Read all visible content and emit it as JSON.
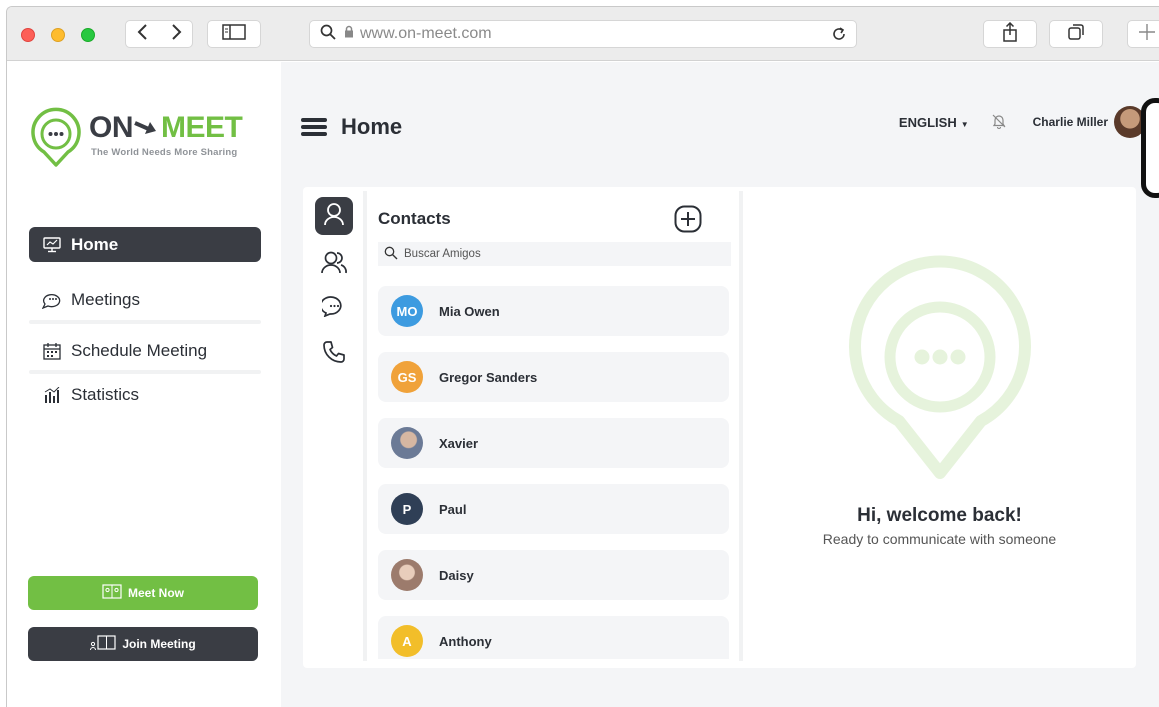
{
  "browser": {
    "url": "www.on-meet.com",
    "colors": {
      "close": "#fd5f57",
      "minimize": "#febc2e",
      "zoom": "#28c840"
    }
  },
  "brand": {
    "name_on": "ON",
    "name_meet": "MEET",
    "tagline": "The World Needs More Sharing",
    "accent": "#72bf44",
    "dark": "#3a3d44"
  },
  "sidebar": {
    "items": [
      {
        "label": "Home",
        "icon": "home-monitor-icon",
        "active": true
      },
      {
        "label": "Meetings",
        "icon": "chat-bubbles-icon",
        "active": false
      },
      {
        "label": "Schedule Meeting",
        "icon": "calendar-icon",
        "active": false
      },
      {
        "label": "Statistics",
        "icon": "bar-stats-icon",
        "active": false
      }
    ],
    "meet_now": "Meet Now",
    "join_meeting": "Join Meeting"
  },
  "header": {
    "title": "Home",
    "language": "ENGLISH",
    "user_name": "Charlie Miller"
  },
  "contacts": {
    "title": "Contacts",
    "search_placeholder": "Buscar Amigos",
    "list": [
      {
        "name": "Mia Owen",
        "initials": "MO",
        "color": "#3d9be0"
      },
      {
        "name": "Gregor Sanders",
        "initials": "GS",
        "color": "#f0a23a"
      },
      {
        "name": "Xavier",
        "initials": "",
        "color": "#7a8aa6"
      },
      {
        "name": "Paul",
        "initials": "P",
        "color": "#2f3f56"
      },
      {
        "name": "Daisy",
        "initials": "",
        "color": "#b89a8e"
      },
      {
        "name": "Anthony",
        "initials": "A",
        "color": "#f2be2a"
      }
    ]
  },
  "welcome": {
    "title": "Hi, welcome back!",
    "subtitle": "Ready to communicate with someone"
  }
}
